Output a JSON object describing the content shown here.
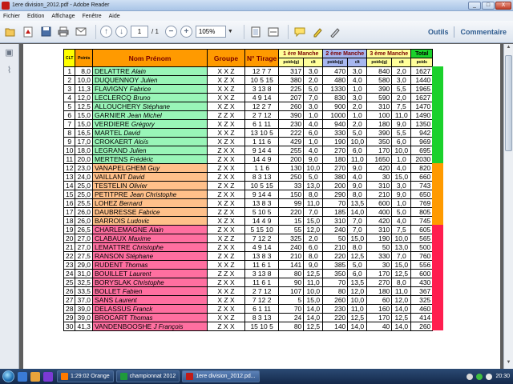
{
  "window": {
    "title": "1ere division_2012.pdf - Adobe Reader",
    "controls": [
      "_",
      "□",
      "X"
    ]
  },
  "menu": [
    "Fichier",
    "Edition",
    "Affichage",
    "Fenêtre",
    "Aide"
  ],
  "toolbar": {
    "page_current": "1",
    "page_total": "/ 1",
    "zoom": "105%",
    "tools_label": "Outils",
    "comment_label": "Commentaire"
  },
  "table": {
    "headers": {
      "clt": "CLT",
      "pts": "Points",
      "name": "Nom Prénom",
      "group": "Groupe",
      "tirage": "N° Tirage",
      "manche1": "1 ère Manche",
      "manche2": "2 ème Manche",
      "manche3": "3 ème Manche",
      "total": "Total",
      "total_sub": "poids",
      "sub_poids": "poids(g)",
      "sub_clt": "clt"
    },
    "rows": [
      {
        "clt": "1",
        "pts": "8,0",
        "nom": "DELATTRE",
        "prenom": "Alain",
        "grp": "X X Z",
        "tir": "12  7  7",
        "p1": "317",
        "c1": "3,0",
        "p2": "470",
        "c2": "3,0",
        "p3": "840",
        "c3": "2,0",
        "tot": "1627",
        "color": "green"
      },
      {
        "clt": "2",
        "pts": "10,0",
        "nom": "DUQUENNOY",
        "prenom": "Julien",
        "grp": "X Z X",
        "tir": "10  5  15",
        "p1": "380",
        "c1": "2,0",
        "p2": "480",
        "c2": "4,0",
        "p3": "580",
        "c3": "3,0",
        "tot": "1440",
        "color": "green"
      },
      {
        "clt": "3",
        "pts": "11,3",
        "nom": "FLAVIGNY",
        "prenom": "Fabrice",
        "grp": "X X Z",
        "tir": "3  13  8",
        "p1": "225",
        "c1": "5,0",
        "p2": "1330",
        "c2": "1,0",
        "p3": "390",
        "c3": "5,5",
        "tot": "1965",
        "color": "green"
      },
      {
        "clt": "4",
        "pts": "12,0",
        "nom": "LECLERCQ",
        "prenom": "Bruno",
        "grp": "X X Z",
        "tir": "4  9  14",
        "p1": "207",
        "c1": "7,0",
        "p2": "830",
        "c2": "3,0",
        "p3": "590",
        "c3": "2,0",
        "tot": "1627",
        "color": "green"
      },
      {
        "clt": "5",
        "pts": "12,5",
        "nom": "ALLOUCHERY",
        "prenom": "Stéphane",
        "grp": "X Z X",
        "tir": "12  2  7",
        "p1": "260",
        "c1": "3,0",
        "p2": "900",
        "c2": "2,0",
        "p3": "310",
        "c3": "7,5",
        "tot": "1470",
        "color": "green"
      },
      {
        "clt": "6",
        "pts": "15,0",
        "nom": "GARNIER",
        "prenom": "Jean Michel",
        "grp": "Z Z X",
        "tir": "2  7  12",
        "p1": "390",
        "c1": "1,0",
        "p2": "1000",
        "c2": "1,0",
        "p3": "100",
        "c3": "11,0",
        "tot": "1490",
        "color": "green"
      },
      {
        "clt": "7",
        "pts": "15,0",
        "nom": "VERDIERE",
        "prenom": "Grégory",
        "grp": "X Z X",
        "tir": "6  1  11",
        "p1": "230",
        "c1": "4,0",
        "p2": "940",
        "c2": "2,0",
        "p3": "180",
        "c3": "9,0",
        "tot": "1350",
        "color": "green"
      },
      {
        "clt": "8",
        "pts": "16,5",
        "nom": "MARTEL",
        "prenom": "David",
        "grp": "X X Z",
        "tir": "13  10  5",
        "p1": "222",
        "c1": "6,0",
        "p2": "330",
        "c2": "5,0",
        "p3": "390",
        "c3": "5,5",
        "tot": "942",
        "color": "green"
      },
      {
        "clt": "9",
        "pts": "17,0",
        "nom": "CROKAERT",
        "prenom": "Aloïs",
        "grp": "X Z X",
        "tir": "1  11  6",
        "p1": "429",
        "c1": "1,0",
        "p2": "190",
        "c2": "10,0",
        "p3": "350",
        "c3": "6,0",
        "tot": "969",
        "color": "green"
      },
      {
        "clt": "10",
        "pts": "18,0",
        "nom": "LEGRAND",
        "prenom": "Julien",
        "grp": "Z X X",
        "tir": "9  14  4",
        "p1": "255",
        "c1": "4,0",
        "p2": "270",
        "c2": "6,0",
        "p3": "170",
        "c3": "10,0",
        "tot": "695",
        "color": "green"
      },
      {
        "clt": "11",
        "pts": "20,0",
        "nom": "MERTENS",
        "prenom": "Frédéric",
        "grp": "Z X X",
        "tir": "14  4  9",
        "p1": "200",
        "c1": "9,0",
        "p2": "180",
        "c2": "11,0",
        "p3": "1650",
        "c3": "1,0",
        "tot": "2030",
        "color": "green"
      },
      {
        "clt": "12",
        "pts": "23,0",
        "nom": "VANAPELGHEM",
        "prenom": "Guy",
        "grp": "Z X X",
        "tir": "1  1  6",
        "p1": "130",
        "c1": "10,0",
        "p2": "270",
        "c2": "9,0",
        "p3": "420",
        "c3": "4,0",
        "tot": "820",
        "color": "orange"
      },
      {
        "clt": "13",
        "pts": "24,0",
        "nom": "VAILLANT",
        "prenom": "David",
        "grp": "Z X X",
        "tir": "8  3  13",
        "p1": "250",
        "c1": "5,0",
        "p2": "380",
        "c2": "4,0",
        "p3": "30",
        "c3": "15,0",
        "tot": "660",
        "color": "orange"
      },
      {
        "clt": "14",
        "pts": "25,0",
        "nom": "TESTELIN",
        "prenom": "Olivier",
        "grp": "Z X Z",
        "tir": "10  5  15",
        "p1": "33",
        "c1": "13,0",
        "p2": "200",
        "c2": "9,0",
        "p3": "310",
        "c3": "3,0",
        "tot": "743",
        "color": "orange"
      },
      {
        "clt": "15",
        "pts": "25,0",
        "nom": "PETITPRE",
        "prenom": "Jean Christophe",
        "grp": "Z X X",
        "tir": "9  14  4",
        "p1": "150",
        "c1": "8,0",
        "p2": "290",
        "c2": "8,0",
        "p3": "210",
        "c3": "9,0",
        "tot": "650",
        "color": "orange"
      },
      {
        "clt": "16",
        "pts": "25,5",
        "nom": "LOHEZ",
        "prenom": "Bernard",
        "grp": "X Z X",
        "tir": "13  8  3",
        "p1": "99",
        "c1": "11,0",
        "p2": "70",
        "c2": "13,5",
        "p3": "600",
        "c3": "1,0",
        "tot": "769",
        "color": "orange"
      },
      {
        "clt": "17",
        "pts": "26,0",
        "nom": "DAUBRESSE",
        "prenom": "Fabrice",
        "grp": "Z Z X",
        "tir": "5  10  5",
        "p1": "220",
        "c1": "7,0",
        "p2": "185",
        "c2": "14,0",
        "p3": "400",
        "c3": "5,0",
        "tot": "805",
        "color": "orange"
      },
      {
        "clt": "18",
        "pts": "26,0",
        "nom": "BARROIS",
        "prenom": "Ludovic",
        "grp": "X Z X",
        "tir": "14  4  9",
        "p1": "15",
        "c1": "15,0",
        "p2": "310",
        "c2": "7,0",
        "p3": "420",
        "c3": "4,0",
        "tot": "745",
        "color": "orange"
      },
      {
        "clt": "19",
        "pts": "26,5",
        "nom": "CHARLEMAGNE",
        "prenom": "Alain",
        "grp": "Z X X",
        "tir": "5  15  10",
        "p1": "55",
        "c1": "12,0",
        "p2": "240",
        "c2": "7,0",
        "p3": "310",
        "c3": "7,5",
        "tot": "605",
        "color": "pink"
      },
      {
        "clt": "20",
        "pts": "27,0",
        "nom": "CLABAUX",
        "prenom": "Maxime",
        "grp": "X Z Z",
        "tir": "7  12  2",
        "p1": "325",
        "c1": "2,0",
        "p2": "50",
        "c2": "15,0",
        "p3": "190",
        "c3": "10,0",
        "tot": "565",
        "color": "pink"
      },
      {
        "clt": "21",
        "pts": "27,0",
        "nom": "LEMATTRE",
        "prenom": "Christophe",
        "grp": "Z X X",
        "tir": "4  9  14",
        "p1": "240",
        "c1": "6,0",
        "p2": "210",
        "c2": "8,0",
        "p3": "50",
        "c3": "13,0",
        "tot": "500",
        "color": "pink"
      },
      {
        "clt": "22",
        "pts": "27,5",
        "nom": "RANSON",
        "prenom": "Stéphane",
        "grp": "Z X Z",
        "tir": "13  8  3",
        "p1": "210",
        "c1": "8,0",
        "p2": "220",
        "c2": "12,5",
        "p3": "330",
        "c3": "7,0",
        "tot": "760",
        "color": "pink"
      },
      {
        "clt": "23",
        "pts": "29,0",
        "nom": "RUDENT",
        "prenom": "Thomas",
        "grp": "X X Z",
        "tir": "11  6  1",
        "p1": "141",
        "c1": "9,0",
        "p2": "385",
        "c2": "5,0",
        "p3": "30",
        "c3": "15,0",
        "tot": "556",
        "color": "pink"
      },
      {
        "clt": "24",
        "pts": "31,0",
        "nom": "BOUILLET",
        "prenom": "Laurent",
        "grp": "Z Z X",
        "tir": "3  13  8",
        "p1": "80",
        "c1": "12,5",
        "p2": "350",
        "c2": "6,0",
        "p3": "170",
        "c3": "12,5",
        "tot": "600",
        "color": "pink"
      },
      {
        "clt": "25",
        "pts": "32,5",
        "nom": "BORYSLAK",
        "prenom": "Christophe",
        "grp": "Z X X",
        "tir": "11  6  1",
        "p1": "90",
        "c1": "11,0",
        "p2": "70",
        "c2": "13,5",
        "p3": "270",
        "c3": "8,0",
        "tot": "430",
        "color": "pink"
      },
      {
        "clt": "26",
        "pts": "33,5",
        "nom": "BOLLET",
        "prenom": "Fabien",
        "grp": "X X Z",
        "tir": "2  7  12",
        "p1": "107",
        "c1": "10,0",
        "p2": "80",
        "c2": "12,0",
        "p3": "180",
        "c3": "11,0",
        "tot": "367",
        "color": "pink"
      },
      {
        "clt": "27",
        "pts": "37,0",
        "nom": "SANS",
        "prenom": "Laurent",
        "grp": "X Z X",
        "tir": "7  12  2",
        "p1": "5",
        "c1": "15,0",
        "p2": "260",
        "c2": "10,0",
        "p3": "60",
        "c3": "12,0",
        "tot": "325",
        "color": "pink"
      },
      {
        "clt": "28",
        "pts": "39,0",
        "nom": "DELASSUS",
        "prenom": "Franck",
        "grp": "Z X X",
        "tir": "6  1  11",
        "p1": "70",
        "c1": "14,0",
        "p2": "230",
        "c2": "11,0",
        "p3": "160",
        "c3": "14,0",
        "tot": "460",
        "color": "pink"
      },
      {
        "clt": "29",
        "pts": "39,0",
        "nom": "BROCART",
        "prenom": "Thomas",
        "grp": "X X Z",
        "tir": "8  3  13",
        "p1": "24",
        "c1": "14,0",
        "p2": "220",
        "c2": "12,5",
        "p3": "170",
        "c3": "12,5",
        "tot": "414",
        "color": "pink"
      },
      {
        "clt": "30",
        "pts": "41,3",
        "nom": "VANDENBOOSHE",
        "prenom": "J François",
        "grp": "Z X X",
        "tir": "15  10  5",
        "p1": "80",
        "c1": "12,5",
        "p2": "140",
        "c2": "14,0",
        "p3": "40",
        "c3": "14,0",
        "tot": "260",
        "color": "pink"
      }
    ]
  },
  "taskbar": {
    "tasks": [
      {
        "label": "1:29:02 Orange",
        "active": false
      },
      {
        "label": "championnat 2012",
        "active": false
      },
      {
        "label": "1ere division_2012.pd...",
        "active": true
      }
    ],
    "clock": "20:30"
  },
  "colors": {
    "green": "#99f5b8",
    "orange": "#ffc08a",
    "pink": "#ff6fa0",
    "header_orange": "#ff9a00",
    "total_green": "#1bd12b"
  }
}
